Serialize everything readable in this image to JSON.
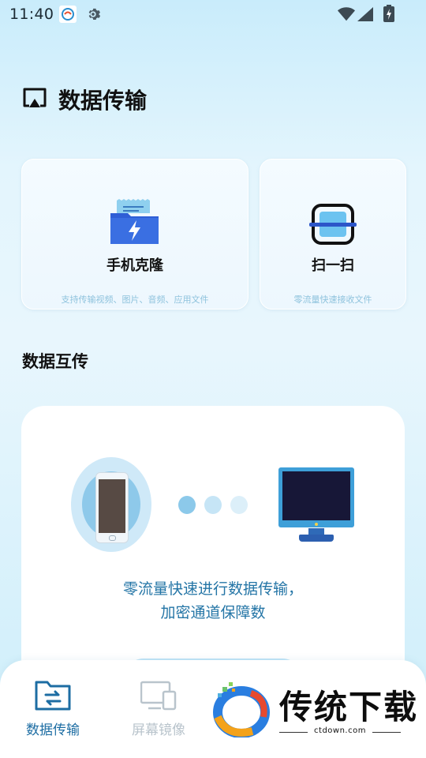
{
  "status_bar": {
    "time": "11:40",
    "icons": [
      "app-notification-icon",
      "gear-icon",
      "wifi-icon",
      "cellular-signal-icon",
      "battery-charging-icon"
    ]
  },
  "header": {
    "title": "数据传输",
    "icon": "screen-cast-icon"
  },
  "cards": [
    {
      "title": "手机克隆",
      "subtitle": "支持传输视频、图片、音频、应用文件",
      "icon": "folder-lightning-icon"
    },
    {
      "title": "扫一扫",
      "subtitle": "零流量快速接收文件",
      "icon": "scan-icon"
    }
  ],
  "section": {
    "title": "数据互传"
  },
  "transfer": {
    "line1": "零流量快速进行数据传输，",
    "line2": "加密通道保障数",
    "illustration": [
      "phone-icon",
      "transfer-dots",
      "monitor-icon"
    ]
  },
  "tabs": [
    {
      "label": "数据传输",
      "icon": "folder-transfer-icon",
      "active": true
    },
    {
      "label": "屏幕镜像",
      "icon": "screen-mirror-icon",
      "active": false
    }
  ],
  "watermark": {
    "brand": "传统下载",
    "url": "ctdown.com"
  },
  "colors": {
    "accent": "#1d6da3",
    "text_blue": "#2475a6",
    "inactive": "#b9c4cc",
    "subtitle": "#8fc3dd"
  }
}
